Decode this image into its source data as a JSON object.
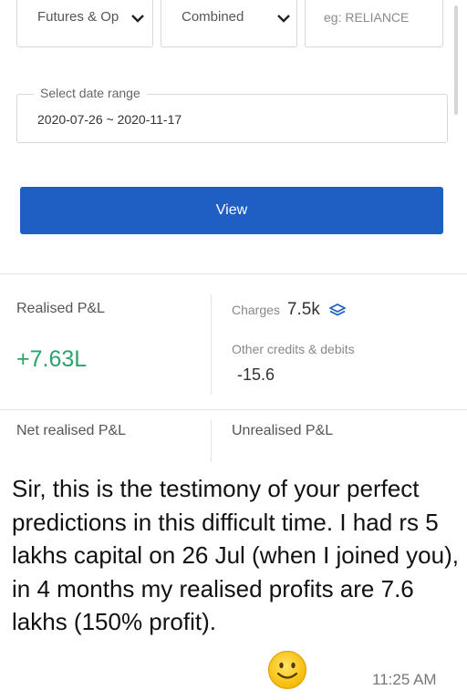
{
  "filters": {
    "segment_value": "Futures & Op",
    "group_value": "Combined",
    "symbol_placeholder": "eg: RELIANCE"
  },
  "date_range": {
    "label": "Select date range",
    "value": "2020-07-26 ~ 2020-11-17"
  },
  "view_button": {
    "label": "View"
  },
  "summary": {
    "realised_label": "Realised P&L",
    "realised_value": "+7.63L",
    "charges_label": "Charges",
    "charges_value": "7.5k",
    "other_label": "Other credits & debits",
    "other_value": "-15.6",
    "net_label": "Net realised P&L",
    "unrealised_label": "Unrealised P&L"
  },
  "chat": {
    "message_text": "Sir, this is the testimony of your perfect predictions in this difficult time. I had rs 5 lakhs capital on 26 Jul (when I joined you), in 4 months my realised profits are 7.6 lakhs (150% profit).",
    "emoji": "smiley-face-icon",
    "timestamp": "11:25 AM"
  },
  "colors": {
    "accent": "#1f5fc4",
    "profit": "#2aa36b"
  }
}
